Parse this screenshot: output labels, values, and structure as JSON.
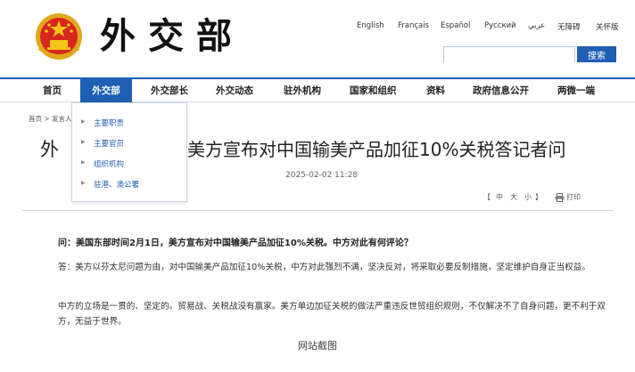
{
  "header": {
    "logo_text": "外交部",
    "languages": [
      "English",
      "Français",
      "Español",
      "Русский",
      "عربي",
      "无障碍",
      "关怀版"
    ],
    "search": {
      "placeholder": "",
      "button_label": "搜索"
    }
  },
  "nav": {
    "items": [
      "首页",
      "外交部",
      "外交部长",
      "外交动态",
      "驻外机构",
      "国家和组织",
      "资料",
      "政府信息公开",
      "两微一端"
    ],
    "active_index": 1
  },
  "dropdown": {
    "items": [
      "主要职责",
      "主要官员",
      "组织机构",
      "驻港、澳公署"
    ]
  },
  "breadcrumb": "首页 > 发言人",
  "article": {
    "title_cut_glyph": "外",
    "title": "就美方宣布对中国输美产品加征10%关税答记者问",
    "date": "2025-02-02 11:28",
    "toolbar": {
      "bracket_open": "【",
      "sizes": [
        "中",
        "大",
        "小"
      ],
      "bracket_close": "】",
      "print_label": "打印"
    },
    "question": "问：美国东部时间2月1日，美方宣布对中国输美产品加征10%关税。中方对此有何评论？",
    "paragraphs": [
      "答：美方以芬太尼问题为由，对中国输美产品加征10%关税，中方对此强烈不满，坚决反对，将采取必要反制措施，坚定维护自身正当权益。",
      "中方的立场是一贯的、坚定的。贸易战、关税战没有赢家。美方单边加征关税的做法严重违反世贸组织规则，不仅解决不了自身问题，更不利于双方，无益于世界。"
    ]
  },
  "caption": "网站截图",
  "colors": {
    "primary": "#1f5fb4",
    "emblem_red": "#d7261e",
    "emblem_gold": "#f5c518"
  }
}
